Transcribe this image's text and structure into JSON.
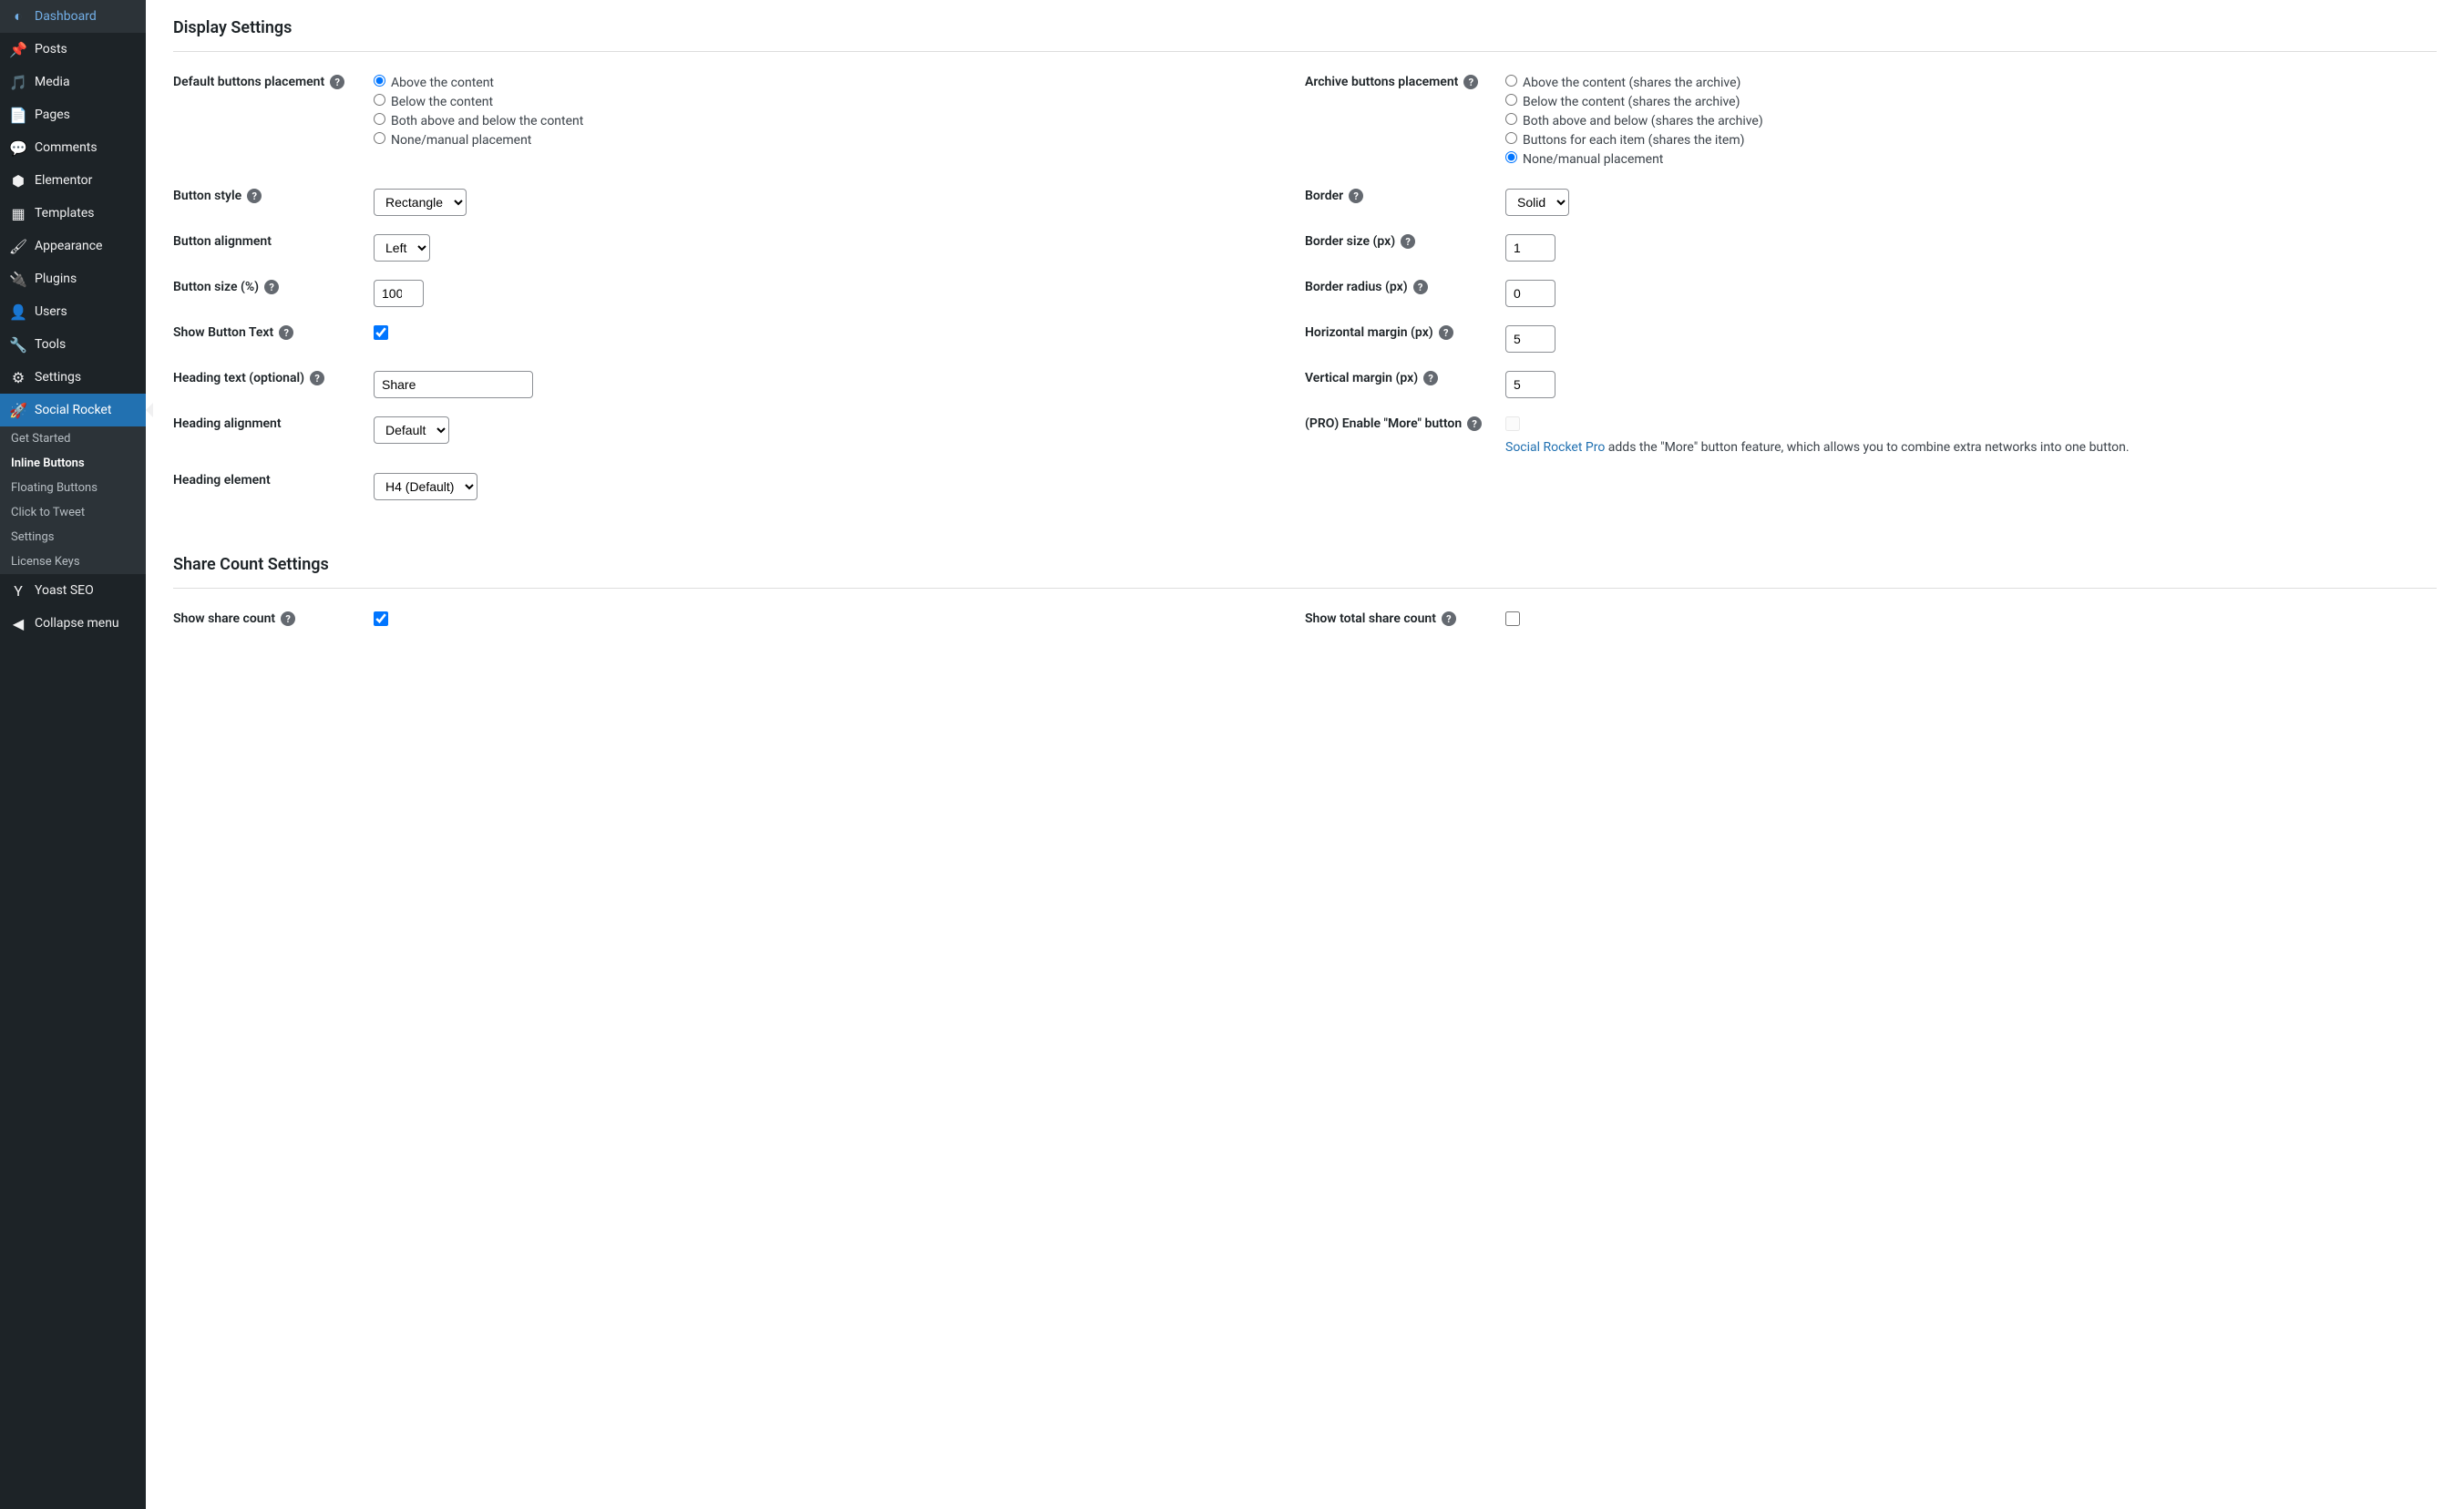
{
  "sidebar": {
    "items": [
      {
        "icon": "◐",
        "label": "Dashboard"
      },
      {
        "icon": "📌",
        "label": "Posts"
      },
      {
        "icon": "🎵",
        "label": "Media"
      },
      {
        "icon": "📄",
        "label": "Pages"
      },
      {
        "icon": "💬",
        "label": "Comments"
      },
      {
        "icon": "⬢",
        "label": "Elementor"
      },
      {
        "icon": "▦",
        "label": "Templates"
      },
      {
        "icon": "🖌",
        "label": "Appearance"
      },
      {
        "icon": "🔌",
        "label": "Plugins"
      },
      {
        "icon": "👤",
        "label": "Users"
      },
      {
        "icon": "🔧",
        "label": "Tools"
      },
      {
        "icon": "⚙",
        "label": "Settings"
      },
      {
        "icon": "🚀",
        "label": "Social Rocket"
      }
    ],
    "submenu": [
      "Get Started",
      "Inline Buttons",
      "Floating Buttons",
      "Click to Tweet",
      "Settings",
      "License Keys"
    ],
    "after": [
      {
        "icon": "Y",
        "label": "Yoast SEO"
      },
      {
        "icon": "◀",
        "label": "Collapse menu"
      }
    ]
  },
  "sections": {
    "display": "Display Settings",
    "shareCount": "Share Count Settings"
  },
  "labels": {
    "defaultPlacement": "Default buttons placement",
    "archivePlacement": "Archive buttons placement",
    "buttonStyle": "Button style",
    "border": "Border",
    "buttonAlignment": "Button alignment",
    "borderSize": "Border size (px)",
    "buttonSize": "Button size (%)",
    "borderRadius": "Border radius (px)",
    "showButtonText": "Show Button Text",
    "horizontalMargin": "Horizontal margin (px)",
    "headingText": "Heading text (optional)",
    "verticalMargin": "Vertical margin (px)",
    "headingAlignment": "Heading alignment",
    "enableMore": "(PRO) Enable \"More\" button",
    "headingElement": "Heading element",
    "showShareCount": "Show share count",
    "showTotalShareCount": "Show total share count"
  },
  "radios": {
    "default": [
      "Above the content",
      "Below the content",
      "Both above and below the content",
      "None/manual placement"
    ],
    "archive": [
      "Above the content (shares the archive)",
      "Below the content (shares the archive)",
      "Both above and below (shares the archive)",
      "Buttons for each item (shares the item)",
      "None/manual placement"
    ]
  },
  "values": {
    "buttonStyle": "Rectangle",
    "border": "Solid",
    "buttonAlignment": "Left",
    "borderSize": "1",
    "buttonSize": "100",
    "borderRadius": "0",
    "horizontalMargin": "5",
    "verticalMargin": "5",
    "headingText": "Share",
    "headingAlignment": "Default",
    "headingElement": "H4 (Default)",
    "proLinkText": "Social Rocket Pro",
    "proDesc": " adds the \"More\" button feature, which allows you to combine extra networks into one button."
  }
}
